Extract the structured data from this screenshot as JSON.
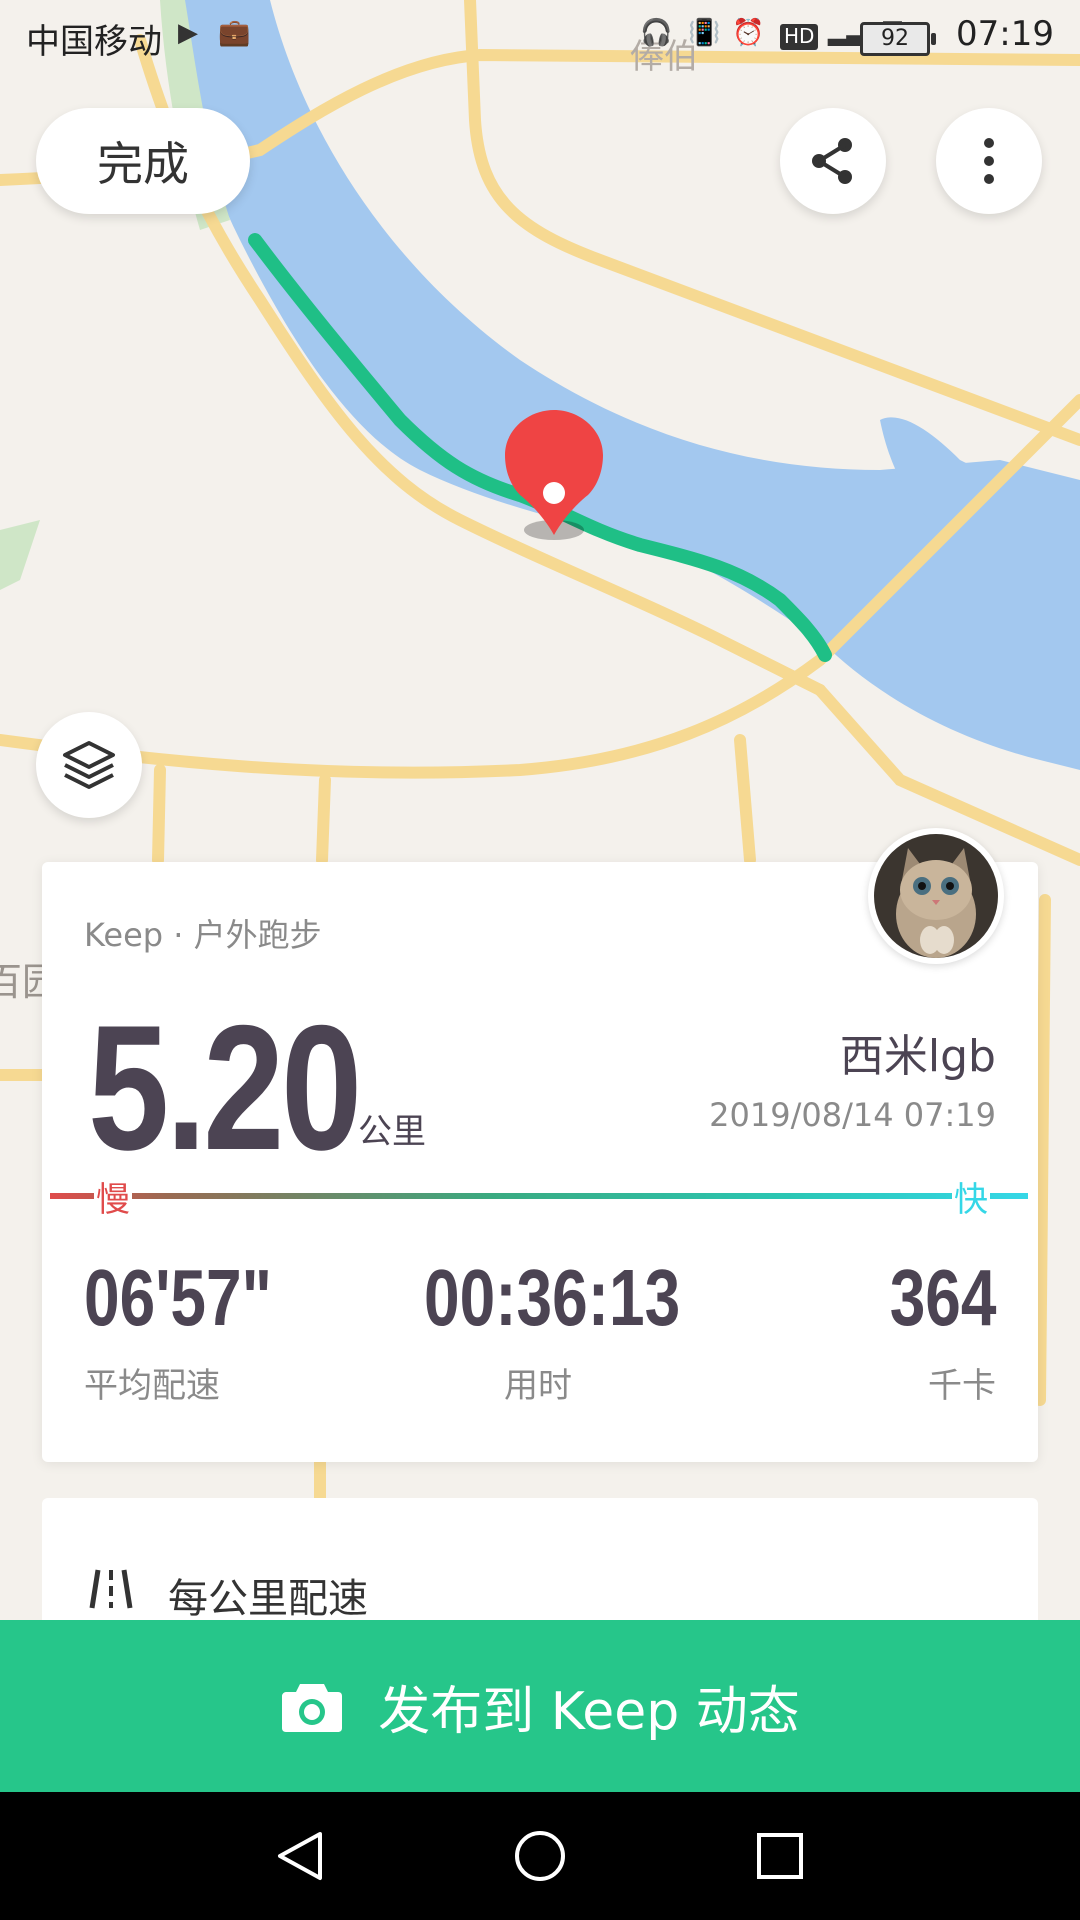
{
  "status_bar": {
    "carrier": "中国移动",
    "time": "07:19",
    "battery": "92"
  },
  "map": {
    "place_label": "俸伯",
    "left_label": "百园"
  },
  "header": {
    "done_label": "完成"
  },
  "summary": {
    "source": "Keep · 户外跑步",
    "distance": "5.20",
    "unit": "公里",
    "user_name": "西米lgb",
    "datetime": "2019/08/14 07:19",
    "slow_label": "慢",
    "fast_label": "快",
    "stats": [
      {
        "value": "06'57\"",
        "label": "平均配速"
      },
      {
        "value": "00:36:13",
        "label": "用时"
      },
      {
        "value": "364",
        "label": "千卡"
      }
    ]
  },
  "pace_section": {
    "title": "每公里配速"
  },
  "publish_button": {
    "label": "发布到 Keep 动态"
  },
  "colors": {
    "accent": "#26c68a",
    "route": "#1fbf86",
    "water": "#a3c8ef",
    "pin": "#ef4444"
  }
}
